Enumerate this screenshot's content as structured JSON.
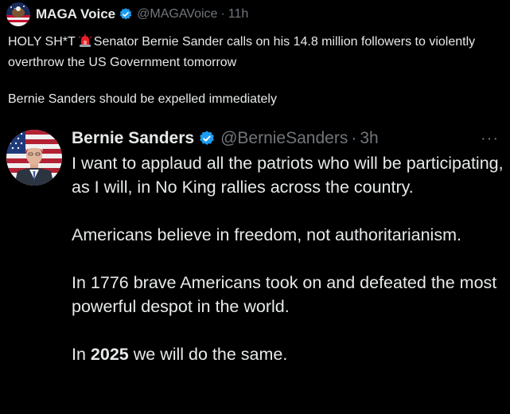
{
  "outer_post": {
    "name": "MAGA Voice",
    "handle": "@MAGAVoice",
    "separator": "·",
    "time": "11h",
    "line1_before": "HOLY SH*T",
    "siren_icon": "rotating-light-emoji",
    "line1_after": "Senator Bernie Sander calls on his 14.8 million followers to violently overthrow the US Government tomorrow",
    "line2": "Bernie Sanders should be expelled immediately"
  },
  "quoted_post": {
    "name": "Bernie Sanders",
    "handle": "@BernieSanders",
    "separator": "·",
    "time": "3h",
    "more_label": "···",
    "paragraph1": "I want to applaud all the patriots who will be participating, as I will, in No King rallies across the country.",
    "paragraph2": "Americans believe in freedom, not authoritarianism.",
    "paragraph3": "In 1776 brave Americans took on and defeated the most powerful despot in the world.",
    "paragraph4_before": "In",
    "paragraph4_bold": "2025",
    "paragraph4_after": "we will do the same."
  },
  "colors": {
    "background": "#000000",
    "primary_text": "#e7e9ea",
    "secondary_text": "#71767b",
    "verified_badge": "#1d9bf0",
    "siren_red": "#e8202a"
  },
  "icons": {
    "outer_avatar": "flag-eagle-avatar",
    "quoted_avatar": "bernie-sanders-avatar",
    "verified": "verified-badge-icon",
    "more": "more-options-icon"
  }
}
